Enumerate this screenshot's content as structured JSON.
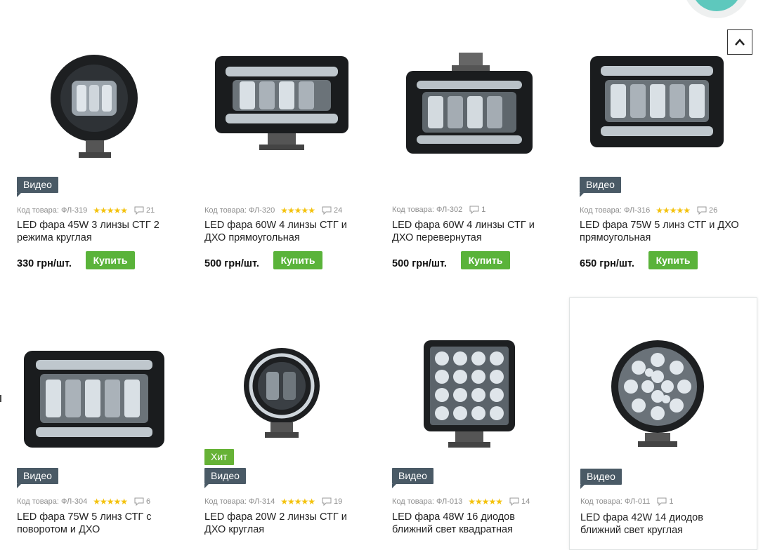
{
  "scroll_top": {
    "icon": "chevron-up-icon"
  },
  "common": {
    "code_prefix": "Код товара:",
    "buy_label": "Купить",
    "video_label": "Видео",
    "hit_label": "Хит",
    "rating_stars": "★★★★★"
  },
  "products": [
    {
      "code": "ФЛ-319",
      "rating": 5,
      "comments": "21",
      "name": "LED фара 45W 3 линзы СТГ 2 режима круглая",
      "price": "330 грн/шт.",
      "video": true,
      "hit": false
    },
    {
      "code": "ФЛ-320",
      "rating": 5,
      "comments": "24",
      "name": "LED фара 60W 4 линзы СТГ и ДХО прямоугольная",
      "price": "500 грн/шт.",
      "video": false,
      "hit": false
    },
    {
      "code": "ФЛ-302",
      "rating": 0,
      "comments": "1",
      "name": "LED фара 60W 4 линзы СТГ и ДХО перевернутая",
      "price": "500 грн/шт.",
      "video": false,
      "hit": false
    },
    {
      "code": "ФЛ-316",
      "rating": 5,
      "comments": "26",
      "name": "LED фара 75W 5 линз СТГ и ДХО прямоугольная",
      "price": "650 грн/шт.",
      "video": true,
      "hit": false
    },
    {
      "code": "ФЛ-304",
      "rating": 5,
      "comments": "6",
      "name": "LED фара 75W 5 линз СТГ с поворотом и ДХО",
      "price": "",
      "video": true,
      "hit": false
    },
    {
      "code": "ФЛ-314",
      "rating": 5,
      "comments": "19",
      "name": "LED фара 20W 2 линзы СТГ и ДХО круглая",
      "price": "",
      "video": true,
      "hit": true
    },
    {
      "code": "ФЛ-013",
      "rating": 5,
      "comments": "14",
      "name": "LED фара 48W 16 диодов ближний свет квадратная",
      "price": "",
      "video": true,
      "hit": false
    },
    {
      "code": "ФЛ-011",
      "rating": 0,
      "comments": "1",
      "name": "LED фара 42W 14 диодов ближний свет круглая",
      "price": "",
      "video": true,
      "hit": false
    }
  ]
}
